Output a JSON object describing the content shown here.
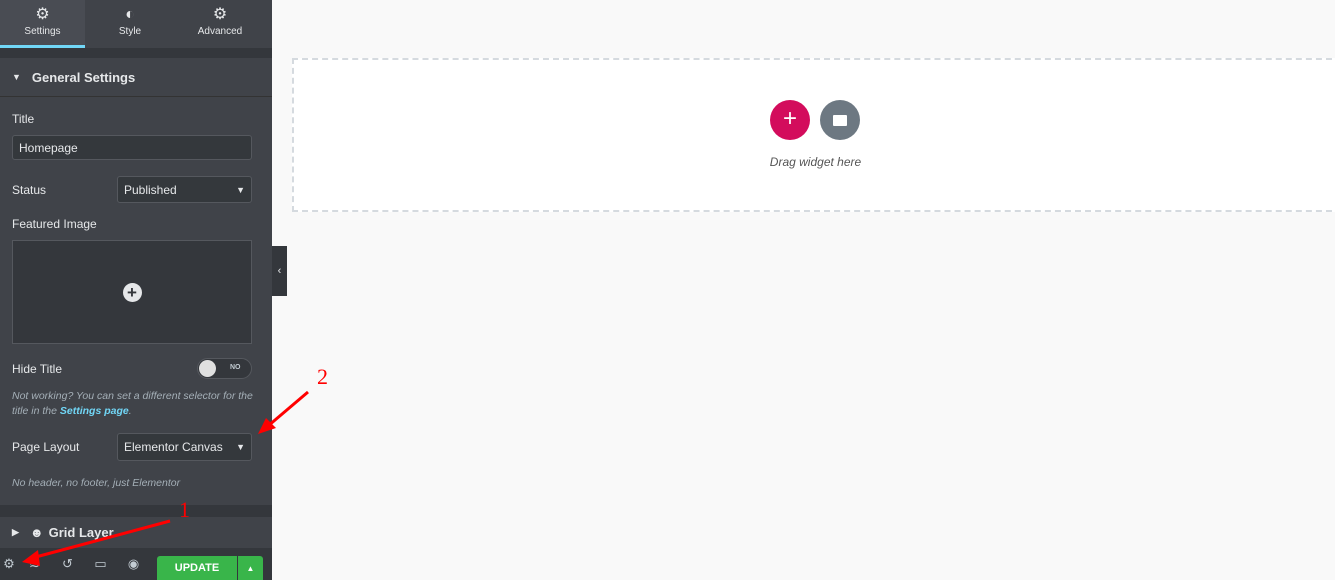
{
  "tabs": [
    {
      "label": "Settings",
      "icon": "gear-icon"
    },
    {
      "label": "Style",
      "icon": "half-circle-icon"
    },
    {
      "label": "Advanced",
      "icon": "gear-icon"
    }
  ],
  "general": {
    "header": "General Settings",
    "title_label": "Title",
    "title_value": "Homepage",
    "status_label": "Status",
    "status_value": "Published",
    "featured_label": "Featured Image",
    "hide_title_label": "Hide Title",
    "toggle_state": "NO",
    "note_prefix": "Not working? You can set a different selector for the title in the ",
    "note_link": "Settings page",
    "note_suffix": ".",
    "layout_label": "Page Layout",
    "layout_value": "Elementor Canvas",
    "layout_note": "No header, no footer, just Elementor"
  },
  "grid": {
    "header": "Grid Layer"
  },
  "footer": {
    "update_label": "UPDATE"
  },
  "canvas": {
    "drag_text": "Drag widget here"
  },
  "annotations": {
    "one": "1",
    "two": "2"
  },
  "colors": {
    "accent": "#71d7f7",
    "update": "#39b54a",
    "add": "#d30c5c",
    "template": "#6d7882"
  }
}
